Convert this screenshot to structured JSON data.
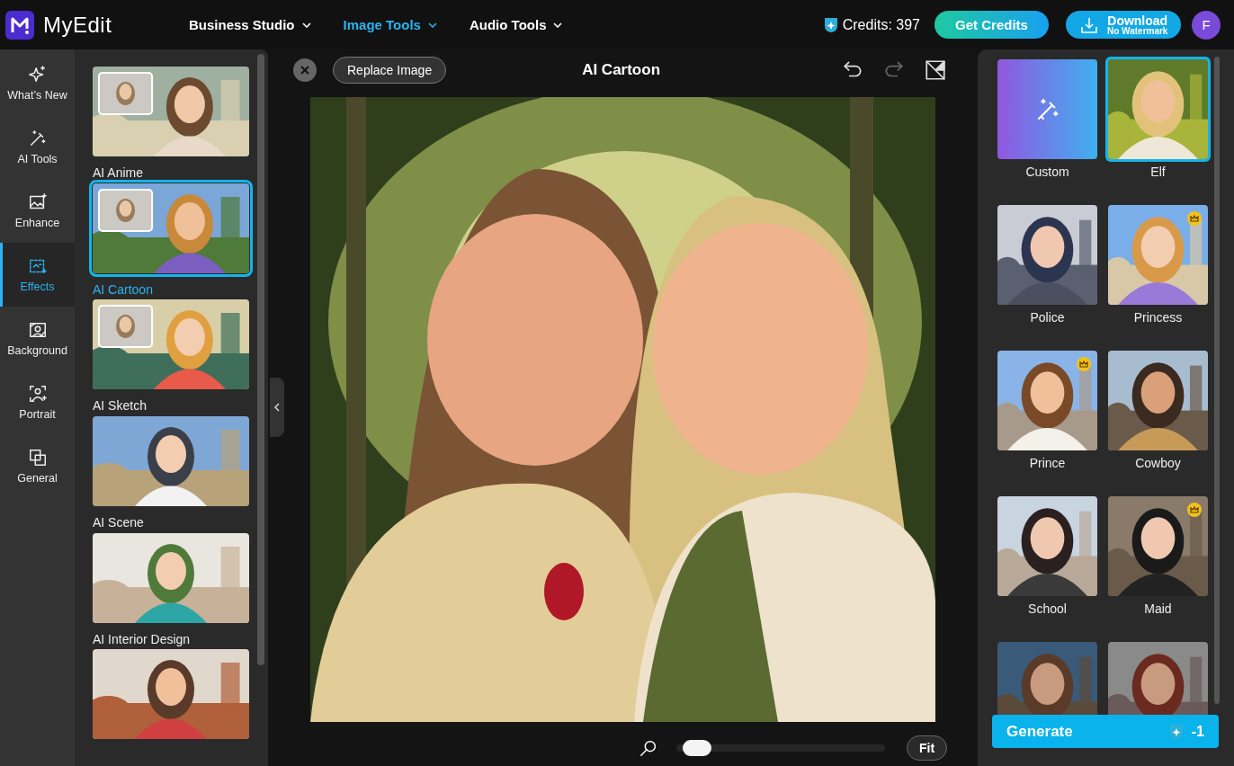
{
  "brand": "MyEdit",
  "nav": [
    {
      "label": "Business Studio",
      "selected": false
    },
    {
      "label": "Image Tools",
      "selected": true
    },
    {
      "label": "Audio Tools",
      "selected": false
    }
  ],
  "credits": "Credits: 397",
  "get_credits": "Get Credits",
  "download": {
    "label": "Download",
    "sublabel": "No Watermark"
  },
  "avatar": "F",
  "rail": [
    {
      "label": "What’s New",
      "selected": false
    },
    {
      "label": "AI Tools",
      "selected": false
    },
    {
      "label": "Enhance",
      "selected": false
    },
    {
      "label": "Effects",
      "selected": true
    },
    {
      "label": "Background",
      "selected": false
    },
    {
      "label": "Portrait",
      "selected": false
    },
    {
      "label": "General",
      "selected": false
    }
  ],
  "effects": [
    {
      "label": "AI Anime",
      "selected": false
    },
    {
      "label": "AI Cartoon",
      "selected": true
    },
    {
      "label": "AI Sketch",
      "selected": false
    },
    {
      "label": "AI Scene",
      "selected": false
    },
    {
      "label": "AI Interior Design",
      "selected": false
    },
    {
      "selected": false
    }
  ],
  "editor": {
    "replace": "Replace Image",
    "title": "AI Cartoon",
    "redo_disabled": true,
    "zoom": {
      "level": 0.07
    },
    "fit": "Fit"
  },
  "styles": [
    {
      "kind": "custom",
      "label": "Custom",
      "selected": false,
      "premium": false
    },
    {
      "kind": "picture",
      "label": "Elf",
      "selected": true,
      "premium": false
    },
    {
      "kind": "picture",
      "label": "Police",
      "selected": false,
      "premium": false
    },
    {
      "kind": "picture",
      "label": "Princess",
      "selected": false,
      "premium": true
    },
    {
      "kind": "picture",
      "label": "Prince",
      "selected": false,
      "premium": true
    },
    {
      "kind": "picture",
      "label": "Cowboy",
      "selected": false,
      "premium": false
    },
    {
      "kind": "picture",
      "label": "School",
      "selected": false,
      "premium": false
    },
    {
      "kind": "picture",
      "label": "Maid",
      "selected": false,
      "premium": true
    },
    {
      "kind": "picture"
    },
    {
      "kind": "picture"
    }
  ],
  "generate": {
    "label": "Generate",
    "cost": "-1"
  }
}
